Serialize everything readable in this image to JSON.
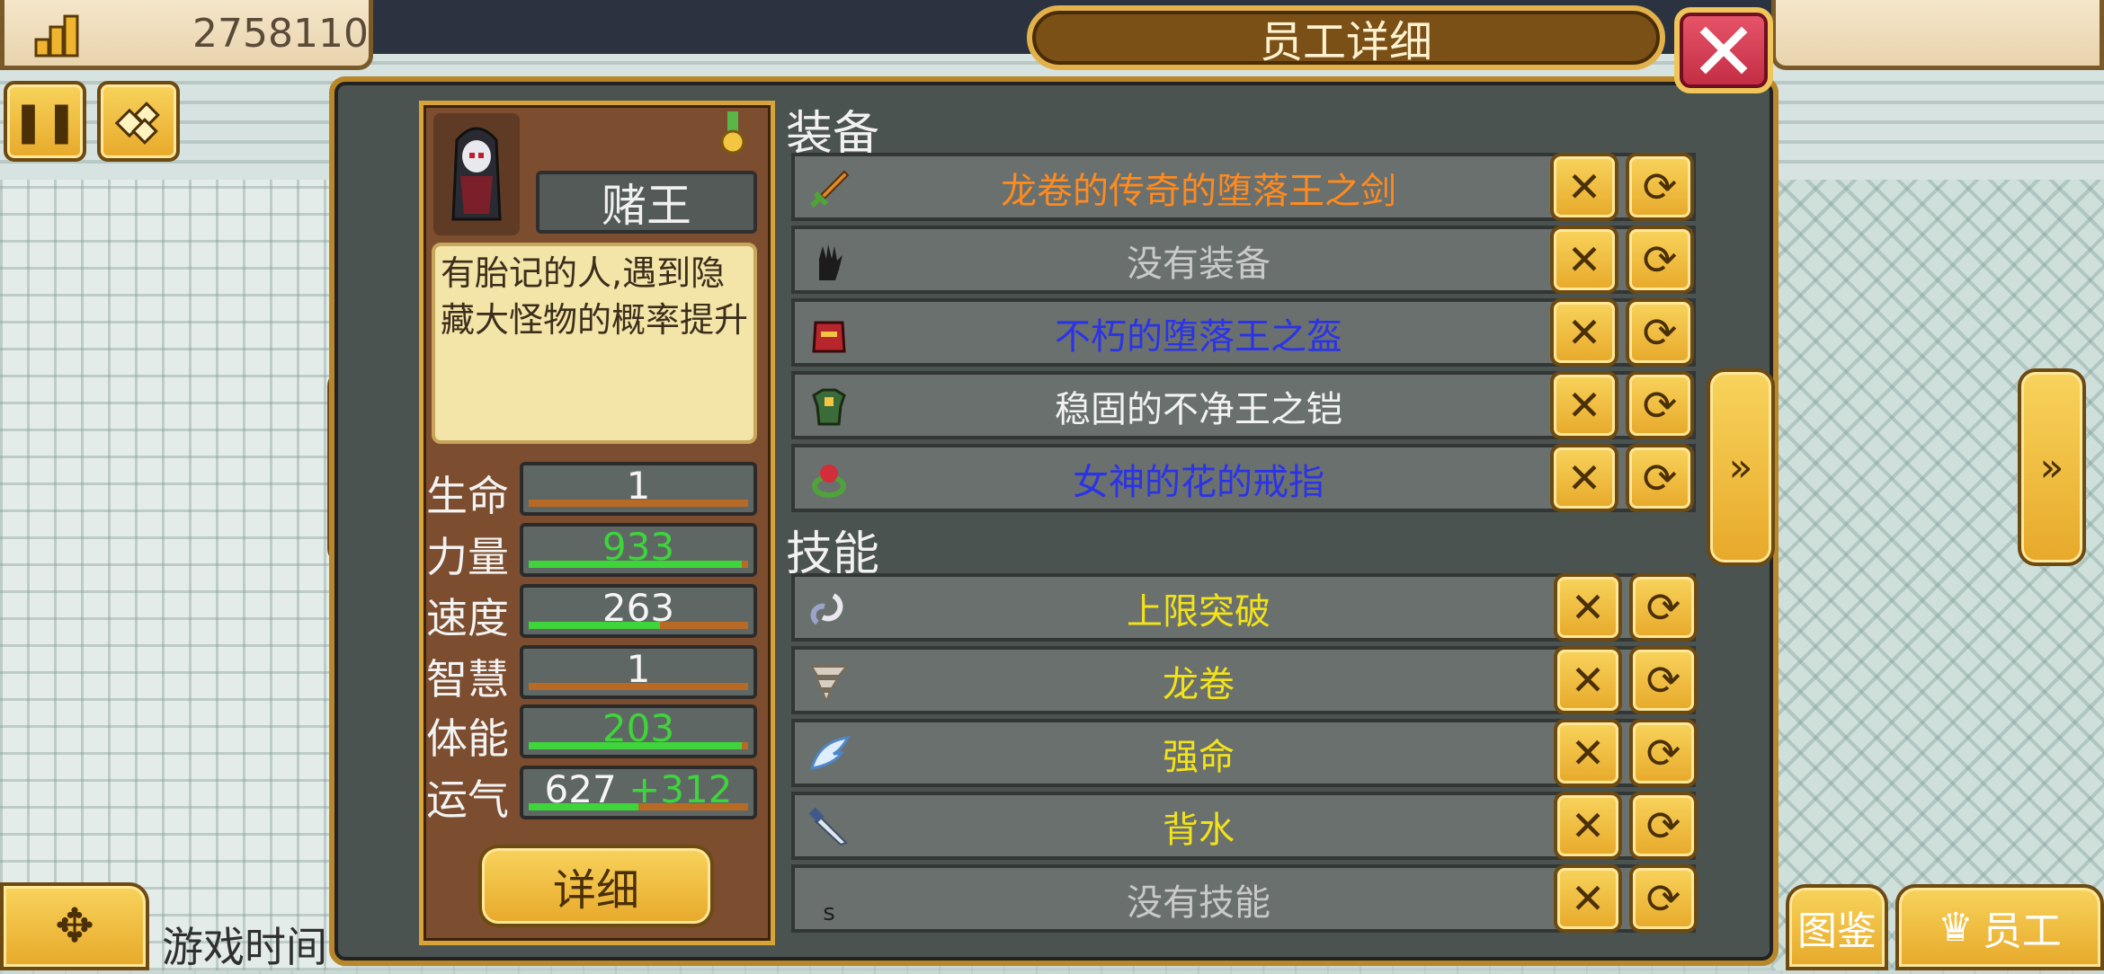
{
  "money": {
    "value": "2758110",
    "icon": "building-stack-icon"
  },
  "title": "员工详细",
  "character": {
    "name": "赌王",
    "description": "有胎记的人,遇到隐藏大怪物的概率提升",
    "stats": [
      {
        "label": "生命",
        "value": "1",
        "bonus": "",
        "fill": 0.0,
        "value_color": "#f5f5f5"
      },
      {
        "label": "力量",
        "value": "933",
        "bonus": "",
        "fill": 0.97,
        "value_color": "#3ed53a"
      },
      {
        "label": "速度",
        "value": "263",
        "bonus": "",
        "fill": 0.6,
        "value_color": "#f5f5f5"
      },
      {
        "label": "智慧",
        "value": "1",
        "bonus": "",
        "fill": 0.0,
        "value_color": "#f5f5f5"
      },
      {
        "label": "体能",
        "value": "203",
        "bonus": "",
        "fill": 0.97,
        "value_color": "#3ed53a"
      },
      {
        "label": "运气",
        "value": "627",
        "bonus": "+312",
        "fill": 0.5,
        "value_color": "#f5f5f5"
      }
    ],
    "detail_label": "详细"
  },
  "equipment": {
    "title": "装备",
    "items": [
      {
        "name": "龙卷的传奇的堕落王之剑",
        "color": "#ff8a1e",
        "icon": "sword-icon"
      },
      {
        "name": "没有装备",
        "color": "#c9c9c9",
        "icon": "glove-icon"
      },
      {
        "name": "不朽的堕落王之盔",
        "color": "#2b33e8",
        "icon": "helmet-icon"
      },
      {
        "name": "稳固的不净王之铠",
        "color": "#f2f2f2",
        "icon": "armor-icon"
      },
      {
        "name": "女神的花的戒指",
        "color": "#2b33e8",
        "icon": "ring-icon"
      }
    ]
  },
  "skills": {
    "title": "技能",
    "items": [
      {
        "name": "上限突破",
        "color": "#f2e21a",
        "icon": "chain-icon"
      },
      {
        "name": "龙卷",
        "color": "#f2e21a",
        "icon": "tornado-icon"
      },
      {
        "name": "强命",
        "color": "#f2e21a",
        "icon": "wing-icon"
      },
      {
        "name": "背水",
        "color": "#f2e21a",
        "icon": "dagger-icon"
      },
      {
        "name": "没有技能",
        "color": "#c9c9c9",
        "icon": "empty-skill-icon",
        "marker": "s"
      }
    ]
  },
  "footer": {
    "game_time_label": "游戏时间",
    "encyclopedia_label": "图鉴",
    "staff_label": "员工"
  },
  "colors": {
    "accent_gold": "#f0c040",
    "dialog_bg": "#4b5351",
    "close_red": "#d43c52"
  }
}
